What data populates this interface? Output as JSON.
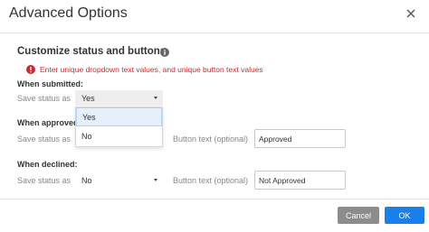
{
  "dialog": {
    "title": "Advanced Options",
    "section_heading": "Customize status and buttons",
    "error_message": "Enter unique dropdown text values, and unique button text values",
    "colors": {
      "error": "#d0282f",
      "primary": "#1a7fe8",
      "cancel": "#8c8c8c"
    }
  },
  "groups": {
    "submitted": {
      "label": "When submitted:",
      "save_label": "Save status as",
      "status": "Yes"
    },
    "approved": {
      "label": "When approved",
      "save_label": "Save status as",
      "button_label": "Button text (optional)",
      "button_text": "Approved"
    },
    "declined": {
      "label": "When declined:",
      "save_label": "Save status as",
      "status": "No",
      "button_label": "Button text (optional)",
      "button_text": "Not Approved"
    }
  },
  "dropdown": {
    "options": [
      "Yes",
      "No"
    ],
    "highlighted": "Yes"
  },
  "footer": {
    "cancel_label": "Cancel",
    "ok_label": "OK"
  }
}
